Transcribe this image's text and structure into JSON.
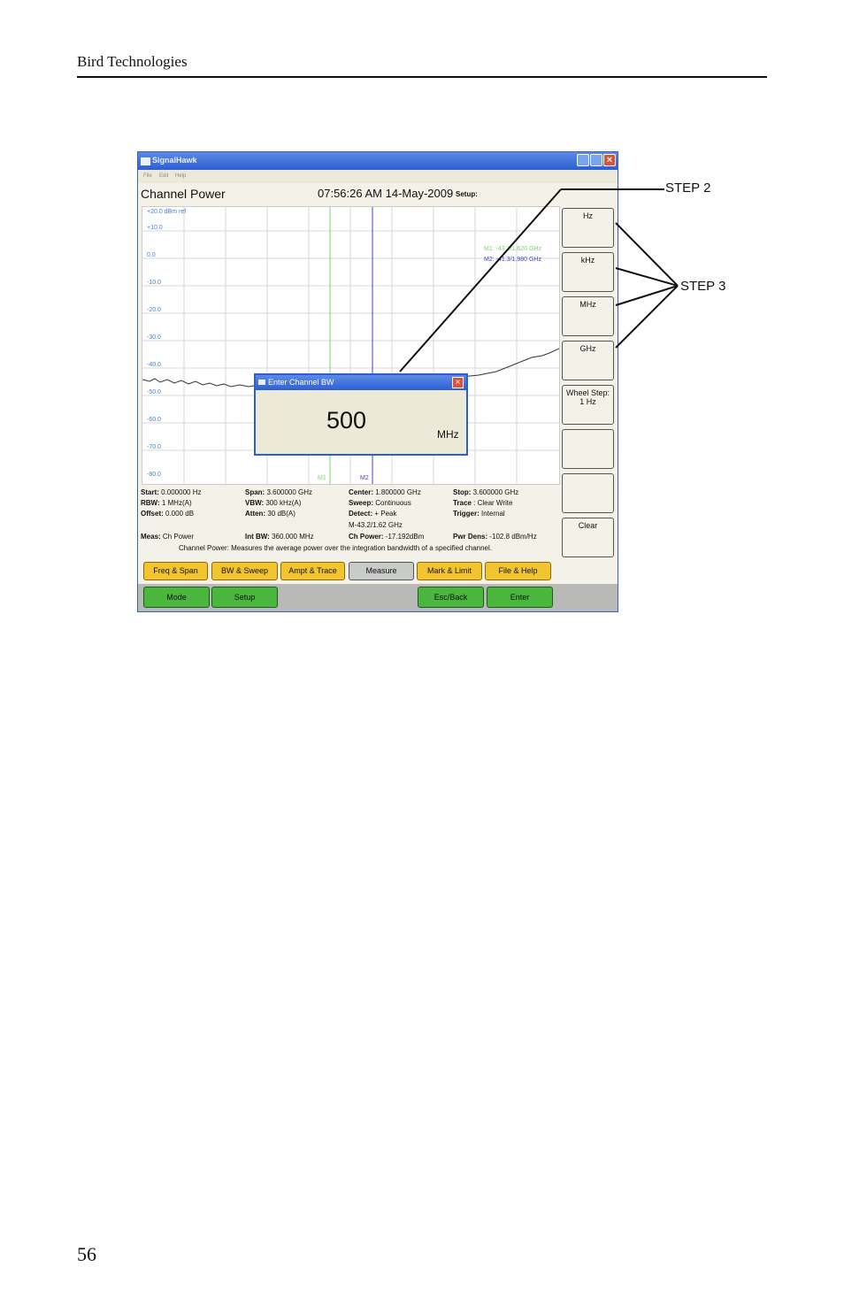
{
  "page": {
    "header": "Bird Technologies",
    "page_number": "56"
  },
  "window": {
    "title": "SignalHawk",
    "menu": [
      "File",
      "Edit",
      "Help"
    ],
    "screen_title": "Channel Power",
    "clock": "07:56:26 AM 14-May-2009",
    "setup_label": "Setup:"
  },
  "plot": {
    "ref_label": "+20.0 dBm ref",
    "y_labels": [
      "+10.0",
      "0.0",
      "-10.0",
      "-20.0",
      "-30.0",
      "-40.0",
      "-50.0",
      "-60.0",
      "-70.0",
      "-80.0"
    ],
    "marker1": "M1: -43.2/1.620 GHz",
    "marker2": "M2: -41.3/1.980 GHz",
    "m1_label": "M1",
    "m2_label": "M2",
    "colors": {
      "marker1": "#7bd36a",
      "marker2": "#3f3fd0",
      "axis": "#4a7ed0"
    }
  },
  "dialog": {
    "title": "Enter Channel BW",
    "value": "500",
    "unit": "MHz"
  },
  "softkeys": [
    "Hz",
    "kHz",
    "MHz",
    "GHz",
    "Wheel Step:\n1 Hz",
    "",
    "",
    "Clear"
  ],
  "info": {
    "start_k": "Start:",
    "start_v": " 0.000000 Hz",
    "rbw_k": "RBW:",
    "rbw_v": " 1 MHz(A)",
    "offset_k": "Offset:",
    "offset_v": "  0.000 dB",
    "meas_k": "Meas:",
    "meas_v": " Ch Power",
    "span_k": "Span:",
    "span_v": " 3.600000 GHz",
    "vbw_k": "VBW:",
    "vbw_v": " 300 kHz(A)",
    "atten_k": "Atten:",
    "atten_v": " 30 dB(A)",
    "intbw_k": "Int BW:",
    "intbw_v": " 360.000 MHz",
    "center_k": "Center:",
    "center_v": " 1.800000 GHz",
    "sweep_k": "Sweep:",
    "sweep_v": " Continuous",
    "detect_k": "Detect:",
    "detect_v": " + Peak",
    "marker_line": "M-43.2/1.62 GHz",
    "chpower_k": "Ch Power:",
    "chpower_v": " -17.192dBm",
    "stop_k": "Stop:",
    "stop_v": " 3.600000 GHz",
    "trace_k": "Trace",
    "trace_v": " : Clear Write",
    "trigger_k": "Trigger:",
    "trigger_v": " Internal",
    "pwrdens_k": "Pwr Dens:",
    "pwrdens_v": " -102.8 dBm/Hz",
    "status": "Channel Power: Measures the average power over the integration bandwidth of a specified channel."
  },
  "tabs": [
    "Freq & Span",
    "BW & Sweep",
    "Ampt & Trace",
    "Measure",
    "Mark & Limit",
    "File & Help"
  ],
  "bottom_buttons": [
    "Mode",
    "Setup",
    "Esc/Back",
    "Enter"
  ],
  "callouts": {
    "step2": "STEP 2",
    "step3": "STEP 3"
  }
}
